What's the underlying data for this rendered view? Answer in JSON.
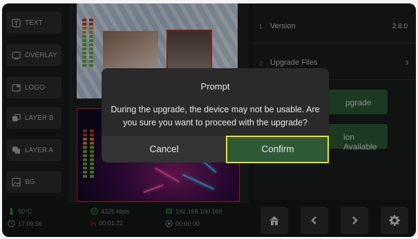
{
  "sidebar": {
    "items": [
      {
        "label": "TEXT",
        "icon": "text-icon"
      },
      {
        "label": "OVERLAY",
        "icon": "overlay-icon"
      },
      {
        "label": "LOGO",
        "icon": "logo-icon"
      },
      {
        "label": "LAYER B",
        "icon": "layer-b-icon"
      },
      {
        "label": "LAYER A",
        "icon": "layer-a-icon"
      },
      {
        "label": "BG",
        "icon": "image-icon"
      }
    ]
  },
  "status": {
    "temperature": "50°C",
    "bitrate": "4225 kbps",
    "ip": "192.168.100.168",
    "clock": "17:09:56",
    "rec_time": "00:01:22",
    "stream_time": "00:00:00",
    "rec_label": "(•)"
  },
  "settings": {
    "version_num": "1",
    "version_label": "Version",
    "version_value": "2.8.0",
    "upgrade_files_num": "2",
    "upgrade_files_label": "Upgrade Files",
    "upgrade_button_partial": "pgrade",
    "new_version_partial": "ion Available"
  },
  "dialog": {
    "title": "Prompt",
    "message": "During the upgrade, the device may not be usable. Are you sure you want to proceed with the upgrade?",
    "cancel_label": "Cancel",
    "confirm_label": "Confirm"
  },
  "colors": {
    "confirm_bg": "#2f5a38",
    "highlight": "#f0e512",
    "accent_red": "#c0332f",
    "status_green": "#28a745"
  }
}
